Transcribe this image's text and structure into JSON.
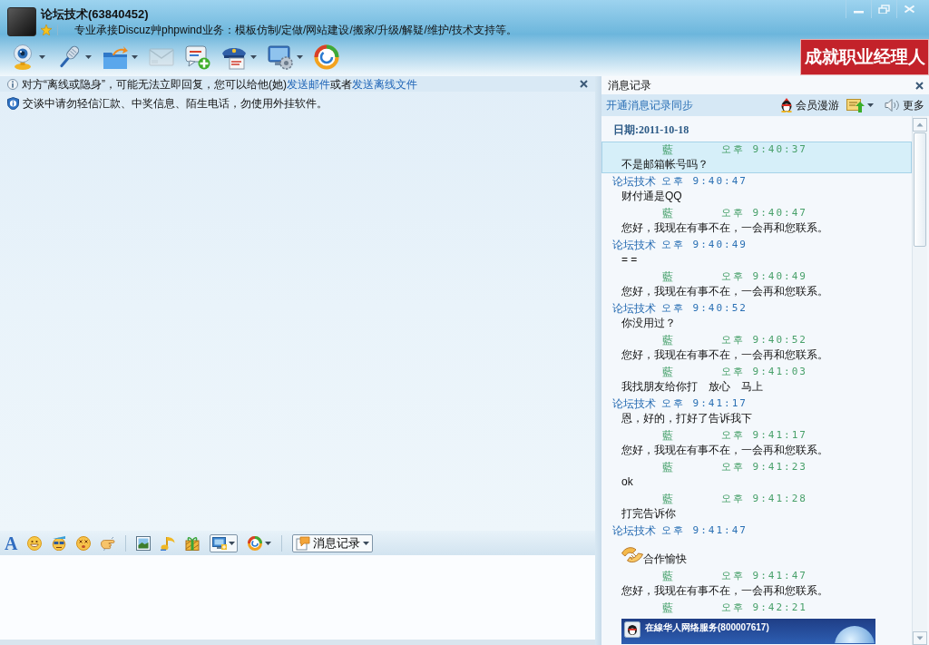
{
  "window": {
    "title": "论坛技术(63840452)",
    "signature": "专业承接Discuz艸phpwind业务：模板仿制/定做/网站建设/搬家/升级/解疑/维护/技术支持等。"
  },
  "toolbar": [
    {
      "kind": "webcam",
      "menu": true,
      "disabled": false
    },
    {
      "kind": "microphone",
      "menu": true,
      "disabled": false
    },
    {
      "kind": "folder",
      "menu": true,
      "disabled": false
    },
    {
      "kind": "mail",
      "menu": false,
      "disabled": true
    },
    {
      "kind": "message",
      "menu": false,
      "disabled": false
    },
    {
      "kind": "officer",
      "menu": true,
      "disabled": false
    },
    {
      "kind": "settings",
      "menu": true,
      "disabled": false
    },
    {
      "kind": "logo",
      "menu": false,
      "disabled": false
    }
  ],
  "banner": {
    "text": "成就职业经理人"
  },
  "notices": [
    {
      "kind": "info",
      "closable": true,
      "segments": [
        {
          "text": "对方“离线或隐身”，可能无法立即回复，您可以给他(她)",
          "link": false
        },
        {
          "text": "发送邮件",
          "link": true
        },
        {
          "text": "或者",
          "link": false
        },
        {
          "text": "发送离线文件",
          "link": true
        }
      ]
    },
    {
      "kind": "shield",
      "closable": false,
      "segments": [
        {
          "text": "交谈中请勿轻信汇款、中奖信息、陌生电话，勿使用外挂软件。",
          "link": false
        }
      ]
    }
  ],
  "input_toolbar": [
    {
      "kind": "font",
      "label": "A"
    },
    {
      "kind": "smiley"
    },
    {
      "kind": "cool_face"
    },
    {
      "kind": "dizzy_face"
    },
    {
      "kind": "pointing_hand"
    },
    {
      "kind": "separator"
    },
    {
      "kind": "picture"
    },
    {
      "kind": "music"
    },
    {
      "kind": "gift"
    },
    {
      "kind": "screenshot",
      "menu": true
    },
    {
      "kind": "logo",
      "menu": true
    },
    {
      "kind": "separator"
    },
    {
      "kind": "history",
      "label": "消息记录",
      "menu": true
    }
  ],
  "history": {
    "title": "消息记录",
    "sync_link": "开通消息记录同步",
    "actions": [
      {
        "kind": "roaming",
        "label": "会员漫游"
      },
      {
        "kind": "export",
        "menu": true
      },
      {
        "kind": "sound"
      },
      {
        "kind": "more",
        "label": "更多"
      }
    ],
    "date": "日期:2011-10-18",
    "messages": [
      {
        "kind": "self",
        "sender": "藍",
        "time": "오후 9:40:37",
        "selected": true,
        "body": {
          "kind": "text",
          "text": "不是邮箱帐号吗？"
        }
      },
      {
        "kind": "contact",
        "sender": "论坛技术",
        "time": "오후 9:40:47",
        "selected": false,
        "body": {
          "kind": "text",
          "text": "财付通是QQ"
        }
      },
      {
        "kind": "self",
        "sender": "藍",
        "time": "오후 9:40:47",
        "selected": false,
        "body": {
          "kind": "text",
          "text": "您好，我现在有事不在，一会再和您联系。"
        }
      },
      {
        "kind": "contact",
        "sender": "论坛技术",
        "time": "오후 9:40:49",
        "selected": false,
        "body": {
          "kind": "text",
          "text": "= ="
        }
      },
      {
        "kind": "self",
        "sender": "藍",
        "time": "오후 9:40:49",
        "selected": false,
        "body": {
          "kind": "text",
          "text": "您好，我现在有事不在，一会再和您联系。"
        }
      },
      {
        "kind": "contact",
        "sender": "论坛技术",
        "time": "오후 9:40:52",
        "selected": false,
        "body": {
          "kind": "text",
          "text": "你没用过？"
        }
      },
      {
        "kind": "self",
        "sender": "藍",
        "time": "오후 9:40:52",
        "selected": false,
        "body": {
          "kind": "text",
          "text": "您好，我现在有事不在，一会再和您联系。"
        }
      },
      {
        "kind": "self",
        "sender": "藍",
        "time": "오후 9:41:03",
        "selected": false,
        "body": {
          "kind": "text",
          "text": "我找朋友给你打　放心　马上"
        }
      },
      {
        "kind": "contact",
        "sender": "论坛技术",
        "time": "오후 9:41:17",
        "selected": false,
        "body": {
          "kind": "text",
          "text": "恩，好的，打好了告诉我下"
        }
      },
      {
        "kind": "self",
        "sender": "藍",
        "time": "오후 9:41:17",
        "selected": false,
        "body": {
          "kind": "text",
          "text": "您好，我现在有事不在，一会再和您联系。"
        }
      },
      {
        "kind": "self",
        "sender": "藍",
        "time": "오후 9:41:23",
        "selected": false,
        "body": {
          "kind": "text",
          "text": "ok"
        }
      },
      {
        "kind": "self",
        "sender": "藍",
        "time": "오후 9:41:28",
        "selected": false,
        "body": {
          "kind": "text",
          "text": "打完告诉你"
        }
      },
      {
        "kind": "contact",
        "sender": "论坛技术",
        "time": "오후 9:41:47",
        "selected": false,
        "body": {
          "kind": "emoji_text",
          "text": "合作愉快"
        }
      },
      {
        "kind": "self",
        "sender": "藍",
        "time": "오후 9:41:47",
        "selected": false,
        "body": {
          "kind": "text",
          "text": "您好，我现在有事不在，一会再和您联系。"
        }
      },
      {
        "kind": "self",
        "sender": "藍",
        "time": "오후 9:42:21",
        "selected": false,
        "body": {
          "kind": "screenshot",
          "title": "在線华人网络服务(800007617)"
        }
      }
    ]
  }
}
